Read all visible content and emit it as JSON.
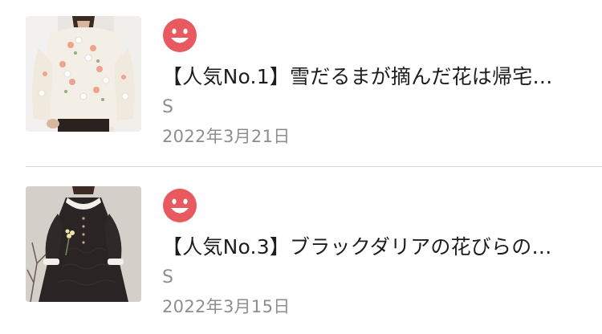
{
  "articles": [
    {
      "title": "【人気No.1】雪だるまが摘んだ花は帰宅…",
      "author": "S",
      "date": "2022年3月21日",
      "icon": "smiley-face-icon"
    },
    {
      "title": "【人気No.3】ブラックダリアの花びらの…",
      "author": "S",
      "date": "2022年3月15日",
      "icon": "smiley-face-icon"
    }
  ],
  "colors": {
    "smiley": "#e85a5f",
    "meta_text": "#8e8e8e",
    "title_text": "#1d1d1d",
    "divider": "#d6d6d6"
  }
}
